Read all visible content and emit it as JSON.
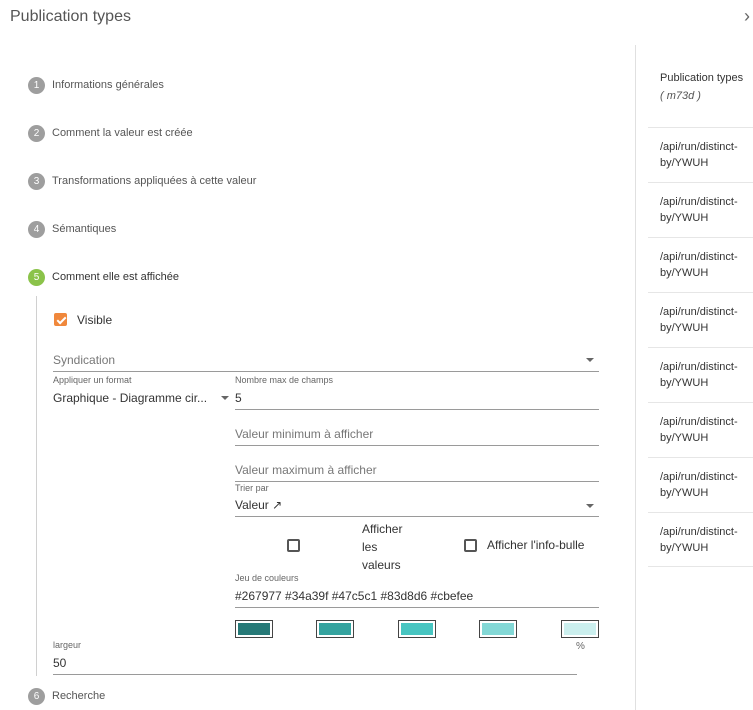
{
  "header": {
    "title": "Publication types",
    "close_glyph": "›"
  },
  "steps": [
    {
      "num": "1",
      "label": "Informations générales"
    },
    {
      "num": "2",
      "label": "Comment la valeur est créée"
    },
    {
      "num": "3",
      "label": "Transformations appliquées à cette valeur"
    },
    {
      "num": "4",
      "label": "Sémantiques"
    },
    {
      "num": "5",
      "label": "Comment elle est affichée"
    },
    {
      "num": "6",
      "label": "Recherche"
    }
  ],
  "form": {
    "visible_label": "Visible",
    "visible_checked": true,
    "syndication_placeholder": "Syndication",
    "format_label": "Appliquer un format",
    "format_value": "Graphique - Diagramme cir...",
    "max_fields_label": "Nombre max de champs",
    "max_fields_value": "5",
    "min_value_placeholder": "Valeur minimum à afficher",
    "max_value_placeholder": "Valeur maximum à afficher",
    "sort_label": "Trier par",
    "sort_value": "Valeur ↗",
    "show_values_line1": "Afficher",
    "show_values_line2": "les",
    "show_values_line3": "valeurs",
    "show_tooltip_label": "Afficher l'info-bulle",
    "colors_label": "Jeu de couleurs",
    "colors_value": "#267977 #34a39f #47c5c1 #83d8d6 #cbefee",
    "swatches": [
      "#267977",
      "#34a39f",
      "#47c5c1",
      "#83d8d6",
      "#cbefee"
    ],
    "percent_sign": "%",
    "width_label": "largeur",
    "width_value": "50"
  },
  "side_panel": {
    "title": "Publication types",
    "subtitle": "( m73d )",
    "items": [
      "/api/run/distinct-by/YWUH",
      "/api/run/distinct-by/YWUH",
      "/api/run/distinct-by/YWUH",
      "/api/run/distinct-by/YWUH",
      "/api/run/distinct-by/YWUH",
      "/api/run/distinct-by/YWUH",
      "/api/run/distinct-by/YWUH",
      "/api/run/distinct-by/YWUH"
    ]
  },
  "colors": {
    "active_step": "#8bc34a",
    "checkbox": "#f0883c",
    "step_inactive": "#9e9e9e"
  }
}
